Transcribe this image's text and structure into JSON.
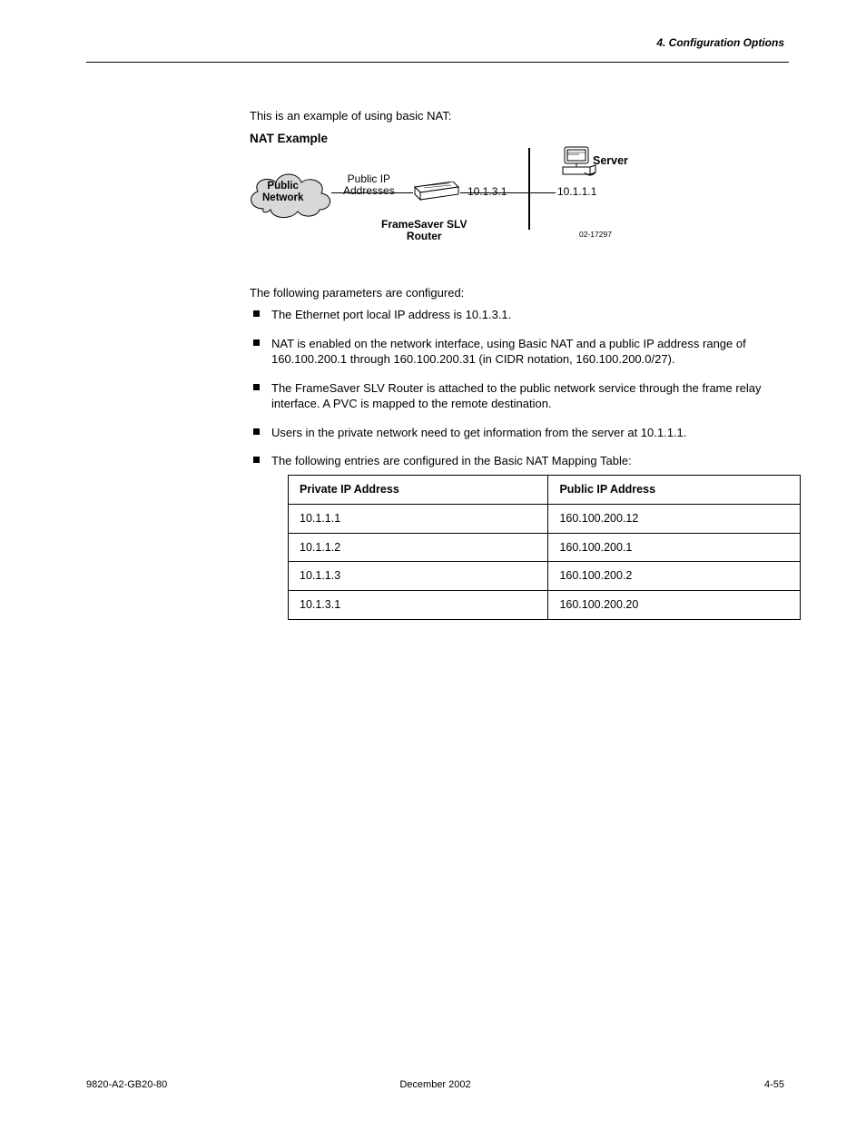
{
  "header": {
    "right": "4. Configuration Options"
  },
  "intro": "This is an example of using basic NAT:",
  "diagram": {
    "title": "NAT Example",
    "cloud_line1": "Public",
    "cloud_line2": "Network",
    "pubip_line1": "Public IP",
    "pubip_line2": "Addresses",
    "router_line1": "FrameSaver SLV",
    "router_line2": "Router",
    "ip_eth": "10.1.3.1",
    "ip_server": "10.1.1.1",
    "server_label": "Server",
    "fig_id": "02-17297"
  },
  "after_diagram": "The following parameters are configured:",
  "bullets": [
    "The Ethernet port local IP address is 10.1.3.1.",
    "NAT is enabled on the network interface, using Basic NAT and a public IP address range of 160.100.200.1 through 160.100.200.31 (in CIDR notation, 160.100.200.0/27).",
    "The FrameSaver SLV Router is attached to the public network service through the frame relay interface. A PVC is mapped to the remote destination.",
    "Users in the private network need to get information from the server at 10.1.1.1.",
    "The following entries are configured in the Basic NAT Mapping Table:"
  ],
  "nat_table": {
    "headers": [
      "Private IP Address",
      "Public IP Address"
    ],
    "rows": [
      [
        "10.1.1.1",
        "160.100.200.12"
      ],
      [
        "10.1.1.2",
        "160.100.200.1"
      ],
      [
        "10.1.1.3",
        "160.100.200.2"
      ],
      [
        "10.1.3.1",
        "160.100.200.20"
      ]
    ]
  },
  "footer": {
    "left": "9820-A2-GB20-80",
    "center": "December 2002",
    "right": "4-55"
  }
}
